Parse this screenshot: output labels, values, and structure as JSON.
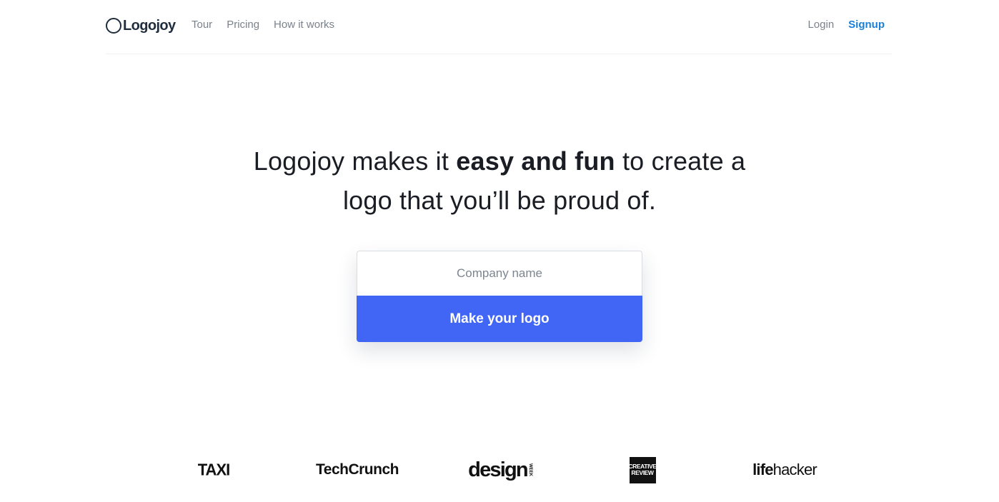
{
  "header": {
    "brand": "Logojoy",
    "nav": [
      {
        "label": "Tour"
      },
      {
        "label": "Pricing"
      },
      {
        "label": "How it works"
      }
    ],
    "login_label": "Login",
    "signup_label": "Signup"
  },
  "hero": {
    "line1_pre": "Logojoy makes it ",
    "line1_bold": "easy and fun",
    "line1_post": " to create a",
    "line2": "logo that you’ll be proud of."
  },
  "form": {
    "input_placeholder": "Company name",
    "input_value": "",
    "button_label": "Make your logo"
  },
  "press": {
    "taxi": "TAXI",
    "techcrunch": "TechCrunch",
    "design": "design",
    "design_side": "WEEK",
    "creative_review_line1": "CREATIVE",
    "creative_review_line2": "REVIEW",
    "lifehacker_bold": "life",
    "lifehacker_rest": "hacker"
  },
  "colors": {
    "accent_button": "#4166f5",
    "signup_link": "#1a7fd6",
    "nav_text": "#7a828c"
  },
  "icons": {
    "brand_mark": "logo-ring-icon"
  }
}
